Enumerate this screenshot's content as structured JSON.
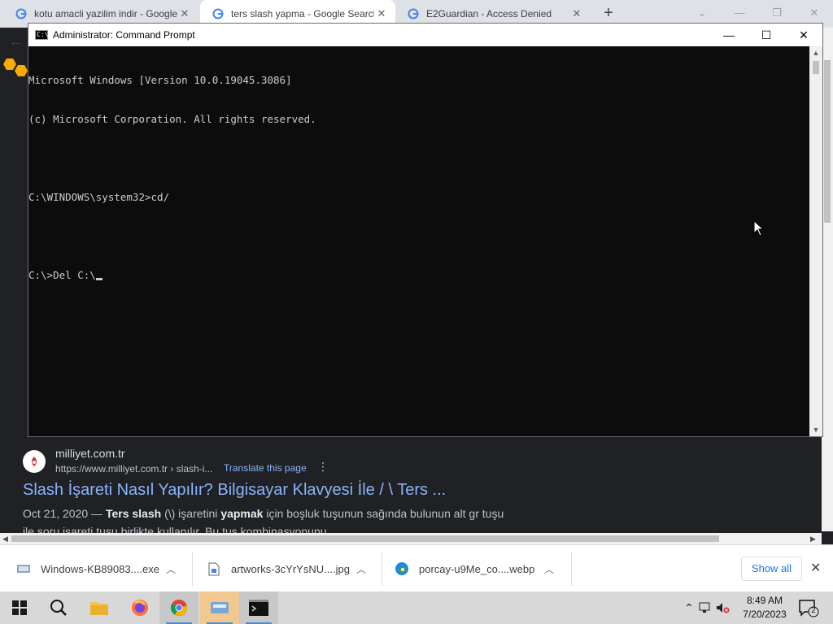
{
  "browser": {
    "tabs": [
      {
        "title": "kotu amacli yazilim indir - Google",
        "close": "✕",
        "active": false
      },
      {
        "title": "ters slash yapma - Google Search",
        "close": "✕",
        "active": true
      },
      {
        "title": "E2Guardian - Access Denied",
        "close": "✕",
        "active": false
      }
    ],
    "new_tab": "+",
    "window_controls": {
      "minimize": "—",
      "restore": "❐",
      "close": "✕",
      "dropdown": "⌄"
    }
  },
  "search_result": {
    "site_name": "milliyet.com.tr",
    "url": "https://www.milliyet.com.tr › slash-i...",
    "translate": "Translate this page",
    "title": "Slash İşareti Nasıl Yapılır? Bilgisayar Klavyesi İle / \\ Ters ...",
    "snippet_date": "Oct 21, 2020 — ",
    "snippet_b1": "Ters slash",
    "snippet_mid": " (\\) işaretini ",
    "snippet_b2": "yapmak",
    "snippet_rest": " için boşluk tuşunun sağında bulunun alt gr tuşu",
    "snippet_line2": "ile soru işareti tuşu birlikte kullanılır. Bu tuş kombinasyonunu..."
  },
  "cmd": {
    "title": "Administrator:  Command Prompt",
    "minimize": "—",
    "maximize": "☐",
    "close": "✕",
    "lines": [
      "Microsoft Windows [Version 10.0.19045.3086]",
      "(c) Microsoft Corporation. All rights reserved.",
      "",
      "C:\\WINDOWS\\system32>cd/",
      "",
      "C:\\>Del C:\\"
    ]
  },
  "downloads": {
    "items": [
      {
        "name": "Windows-KB89083....exe",
        "icon": "installer-icon"
      },
      {
        "name": "artworks-3cYrYsNU....jpg",
        "icon": "image-file-icon"
      },
      {
        "name": "porcay-u9Me_co....webp",
        "icon": "edge-icon"
      }
    ],
    "show_all": "Show all",
    "close": "✕"
  },
  "taskbar": {
    "time": "8:49 AM",
    "date": "7/20/2023",
    "notifications": "2"
  }
}
